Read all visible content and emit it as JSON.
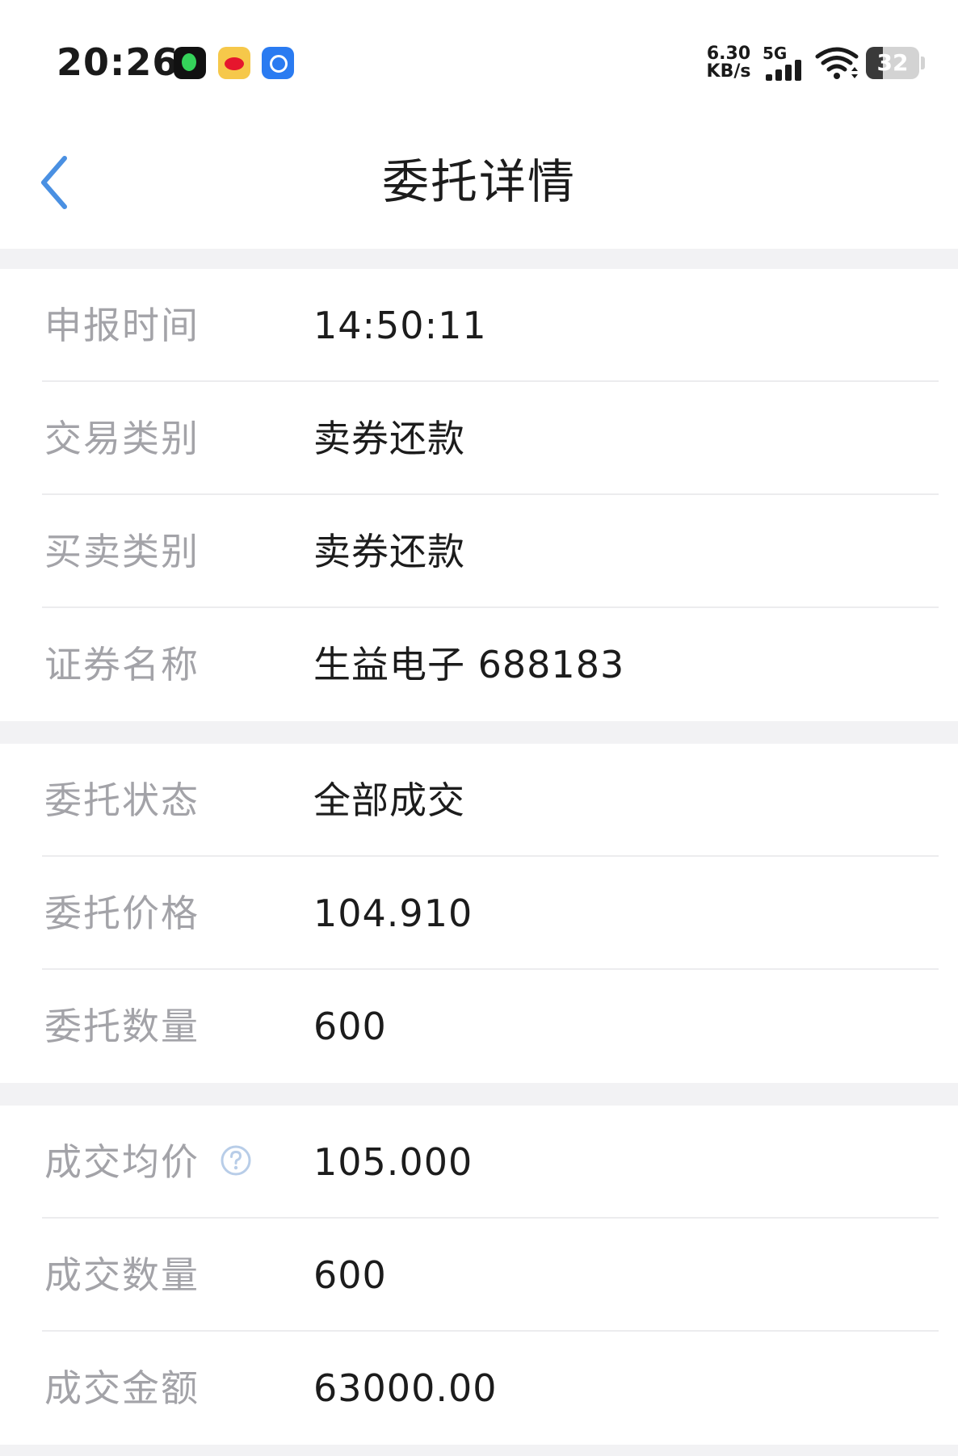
{
  "status_bar": {
    "time": "20:26",
    "net_speed_value": "6.30",
    "net_speed_unit": "KB/s",
    "network_type": "5G",
    "battery": "32",
    "battery_level_percent": 32,
    "notification_icons": [
      "music-app-icon",
      "weibo-icon",
      "blue-app-icon"
    ]
  },
  "header": {
    "title": "委托详情",
    "back_icon": "chevron-left-icon",
    "accent_color": "#4a90e2"
  },
  "sections": [
    {
      "rows": [
        {
          "label": "申报时间",
          "value": "14:50:11"
        },
        {
          "label": "交易类别",
          "value": "卖券还款"
        },
        {
          "label": "买卖类别",
          "value": "卖券还款"
        },
        {
          "label": "证券名称",
          "value": "生益电子 688183"
        }
      ]
    },
    {
      "rows": [
        {
          "label": "委托状态",
          "value": "全部成交"
        },
        {
          "label": "委托价格",
          "value": "104.910"
        },
        {
          "label": "委托数量",
          "value": "600"
        }
      ]
    },
    {
      "rows": [
        {
          "label": "成交均价",
          "value": "105.000",
          "help_icon": "question-circle-icon"
        },
        {
          "label": "成交数量",
          "value": "600"
        },
        {
          "label": "成交金额",
          "value": "63000.00"
        }
      ]
    }
  ]
}
